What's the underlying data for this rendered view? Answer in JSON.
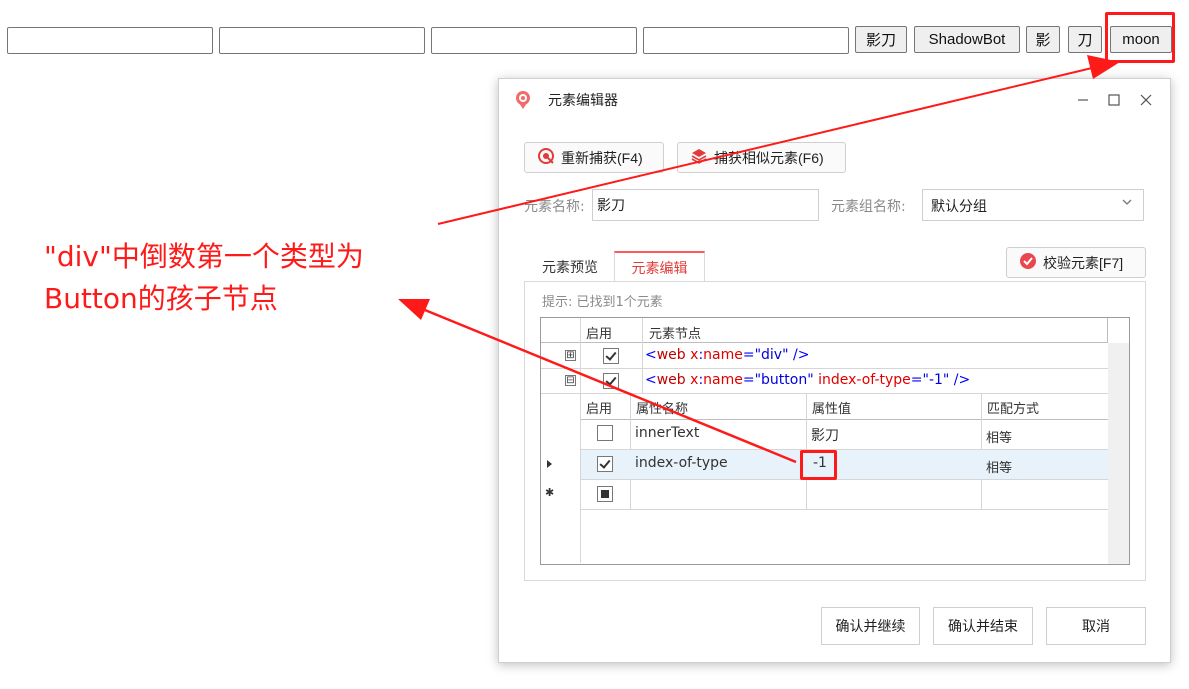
{
  "page": {
    "buttons": [
      {
        "label": "影刀"
      },
      {
        "label": "ShadowBot"
      },
      {
        "label": "影"
      },
      {
        "label": "刀"
      },
      {
        "label": "moon"
      }
    ]
  },
  "dialog": {
    "title": "元素编辑器",
    "window_controls": [
      "minimize",
      "maximize",
      "close"
    ],
    "toolbar": {
      "recapture": "重新捕获(F4)",
      "capture_similar": "捕获相似元素(F6)"
    },
    "element_name_label": "元素名称:",
    "element_name_value": "影刀",
    "group_name_label": "元素组名称:",
    "group_name_value": "默认分组",
    "tabs": [
      {
        "label": "元素预览",
        "active": false
      },
      {
        "label": "元素编辑",
        "active": true
      }
    ],
    "validate_button": "校验元素[F7]",
    "hint": "提示: 已找到1个元素",
    "node_grid": {
      "headers": [
        "启用",
        "元素节点"
      ],
      "rows": [
        {
          "expander": "⊞",
          "enabled": true,
          "tag_open": "<",
          "tag": "web",
          "attr1": "x",
          "colon": ":",
          "attr1b": "name",
          "eq": "=",
          "val1": "\"div\"",
          "rest": " />"
        },
        {
          "expander": "⊟",
          "enabled": true,
          "tag_open": "<",
          "tag": "web",
          "attr1": "x",
          "colon": ":",
          "attr1b": "name",
          "eq": "=",
          "val1": "\"button\"",
          "attr2": " index-of-type",
          "eq2": "=",
          "val2": "\"-1\"",
          "rest": " />"
        }
      ]
    },
    "attr_grid": {
      "headers": [
        "启用",
        "属性名称",
        "属性值",
        "匹配方式"
      ],
      "rows": [
        {
          "enabled": false,
          "name": "innerText",
          "value": "影刀",
          "match": "相等"
        },
        {
          "enabled": true,
          "name": "index-of-type",
          "value": "-1",
          "match": "相等"
        },
        {
          "enabled": "indeterminate",
          "name": "",
          "value": "",
          "match": ""
        }
      ]
    },
    "footer": {
      "confirm_continue": "确认并继续",
      "confirm_finish": "确认并结束",
      "cancel": "取消"
    }
  },
  "annotation": {
    "line1": "\"div\"中倒数第一个类型为",
    "line2": "Button的孩子节点",
    "color": "#ff1a1a"
  },
  "colors": {
    "accent": "#e23b3b",
    "annotation": "#ff1a1a",
    "selected_row": "#e8f2fb"
  }
}
